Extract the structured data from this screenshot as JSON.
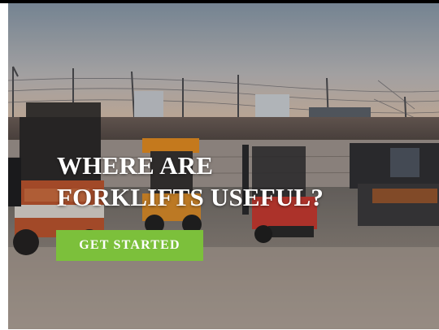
{
  "hero": {
    "title_line1": "WHERE ARE",
    "title_line2": "FORKLIFTS USEFUL?",
    "cta_label": "GET STARTED"
  },
  "colors": {
    "cta_background": "#7cc03b",
    "title_text": "#ffffff"
  }
}
